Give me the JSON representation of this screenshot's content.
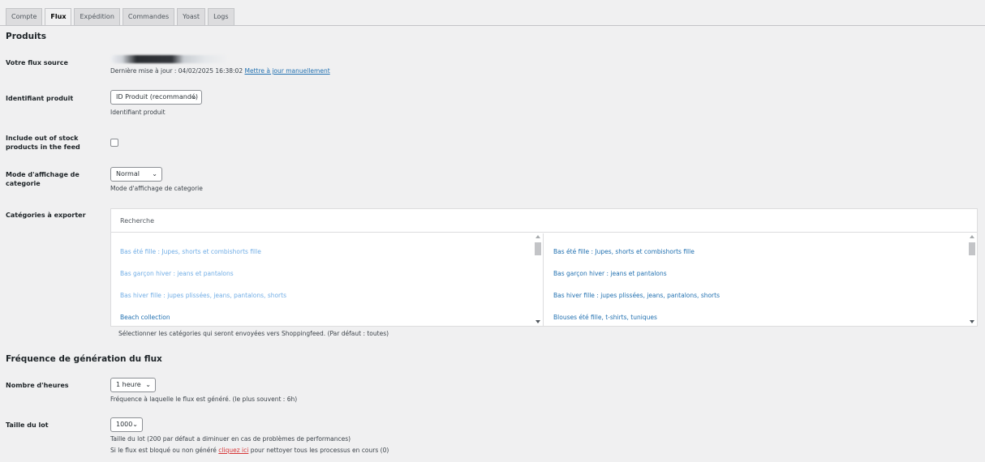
{
  "tabs": [
    {
      "label": "Compte"
    },
    {
      "label": "Flux"
    },
    {
      "label": "Expédition"
    },
    {
      "label": "Commandes"
    },
    {
      "label": "Yoast"
    },
    {
      "label": "Logs"
    }
  ],
  "products": {
    "heading": "Produits",
    "feed_source": {
      "label": "Votre flux source",
      "last_update_prefix": "Dernière mise à jour : 04/02/2025 16:38:02",
      "manual_update_link": "Mettre à jour manuellement"
    },
    "product_id": {
      "label": "Identifiant produit",
      "value": "ID Produit (recommandé)",
      "help": "Identifiant produit"
    },
    "out_of_stock": {
      "label": "Include out of stock products in the feed",
      "checked": false
    },
    "category_display": {
      "label": "Mode d'affichage de categorie",
      "value": "Normal",
      "help": "Mode d'affichage de categorie"
    },
    "categories": {
      "label": "Catégories à exporter",
      "search_placeholder": "Recherche",
      "available": [
        {
          "label": "Bas été fille : Jupes, shorts et combishorts fille"
        },
        {
          "label": "Bas garçon hiver : jeans et pantalons"
        },
        {
          "label": "Bas hiver fille : jupes plissées, jeans, pantalons, shorts"
        },
        {
          "label": "Beach collection"
        }
      ],
      "selected": [
        {
          "label": "Bas été fille : Jupes, shorts et combishorts fille"
        },
        {
          "label": "Bas garçon hiver : jeans et pantalons"
        },
        {
          "label": "Bas hiver fille : jupes plissées, jeans, pantalons, shorts"
        },
        {
          "label": "Blouses été fille, t-shirts, tuniques"
        }
      ],
      "help": "Sélectionner les catégories qui seront envoyées vers Shoppingfeed. (Par défaut : toutes)"
    }
  },
  "frequency": {
    "heading": "Fréquence de génération du flux",
    "hours": {
      "label": "Nombre d'heures",
      "value": "1 heure",
      "help": "Fréquence à laquelle le flux est généré. (le plus souvent : 6h)"
    },
    "batch": {
      "label": "Taille du lot",
      "value": "1000",
      "help": "Taille du lot (200 par défaut a diminuer en cas de problèmes de performances)",
      "blocked_prefix": "Si le flux est bloqué ou non généré",
      "blocked_link": "cliquez ici",
      "blocked_suffix": "pour nettoyer tous les processus en cours (0)"
    }
  },
  "icons": {
    "chevron": "chevron-down-icon"
  }
}
